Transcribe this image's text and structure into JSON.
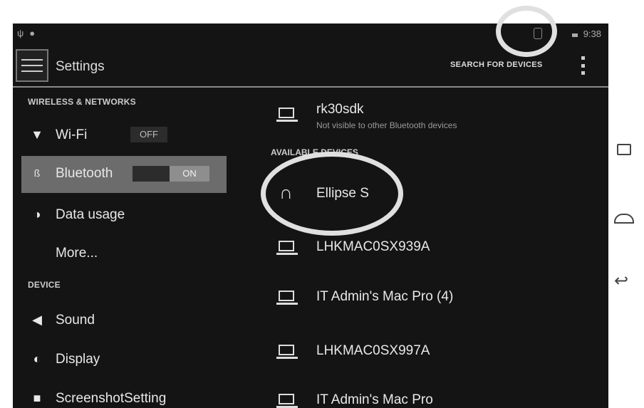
{
  "status_bar": {
    "time": "9:38"
  },
  "action_bar": {
    "title": "Settings",
    "search_label": "SEARCH FOR DEVICES"
  },
  "sidebar": {
    "section_wireless": "WIRELESS & NETWORKS",
    "wifi": {
      "label": "Wi-Fi",
      "toggle": "OFF"
    },
    "bluetooth": {
      "label": "Bluetooth",
      "toggle": "ON"
    },
    "data_usage": {
      "label": "Data usage"
    },
    "more": {
      "label": "More..."
    },
    "section_device": "DEVICE",
    "sound": {
      "label": "Sound"
    },
    "display": {
      "label": "Display"
    },
    "screenshot": {
      "label": "ScreenshotSetting"
    }
  },
  "main": {
    "this_device": {
      "name": "rk30sdk",
      "status": "Not visible to other Bluetooth devices"
    },
    "available_header": "AVAILABLE DEVICES",
    "devices": [
      {
        "name": "Ellipse S",
        "icon": "headphones-icon"
      },
      {
        "name": "LHKMAC0SX939A",
        "icon": "laptop-icon"
      },
      {
        "name": "IT Admin's Mac Pro (4)",
        "icon": "laptop-icon"
      },
      {
        "name": "LHKMAC0SX997A",
        "icon": "laptop-icon"
      },
      {
        "name": "IT Admin's Mac Pro",
        "icon": "laptop-icon"
      }
    ]
  },
  "colors": {
    "background": "#141414",
    "selected": "#6c6c6c",
    "text": "#e8e8e8"
  }
}
